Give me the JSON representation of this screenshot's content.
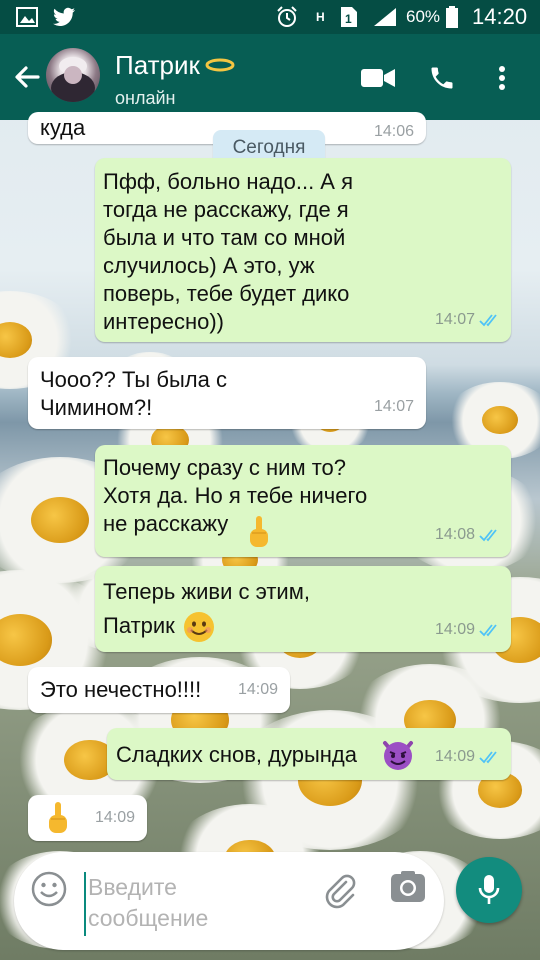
{
  "status_bar": {
    "battery_percent": "60%",
    "time": "14:20",
    "network": "H"
  },
  "header": {
    "contact_name": "Патрик",
    "contact_status": "онлайн"
  },
  "chat": {
    "date_label": "Сегодня",
    "partial_message": {
      "text": "куда",
      "time": "14:06"
    },
    "messages": [
      {
        "dir": "out",
        "text": "Пфф, больно надо... А я\nтогда не расскажу, где я\nбыла и что там со мной\nслучилось) А это, уж\nповерь, тебе будет дико\nинтересно))",
        "time": "14:07",
        "read": true
      },
      {
        "dir": "in",
        "text": "Чооо?? Ты была с\nЧимином?!",
        "time": "14:07"
      },
      {
        "dir": "out",
        "text": "Почему сразу с ним то?\nХотя да. Но я тебе ничего\nне расскажу",
        "emoji": "middle-finger",
        "time": "14:08",
        "read": true
      },
      {
        "dir": "out",
        "text": "Теперь живи с этим,\nПатрик",
        "emoji": "smiling-face",
        "time": "14:09",
        "read": true
      },
      {
        "dir": "in",
        "text": "Это нечестно!!!!",
        "time": "14:09"
      },
      {
        "dir": "out",
        "text": "Сладких снов, дурында",
        "emoji": "devil-face",
        "time": "14:09",
        "read": true
      },
      {
        "dir": "in",
        "text": "",
        "emoji": "middle-finger",
        "time": "14:09"
      }
    ]
  },
  "composer": {
    "placeholder": "Введите\nсообщение"
  },
  "colors": {
    "header": "#075e54",
    "status_bar": "#054d44",
    "outgoing_bubble": "#dcf8c6",
    "incoming_bubble": "#ffffff",
    "read_ticks": "#4fc3f7",
    "mic_button": "#128c7e"
  }
}
